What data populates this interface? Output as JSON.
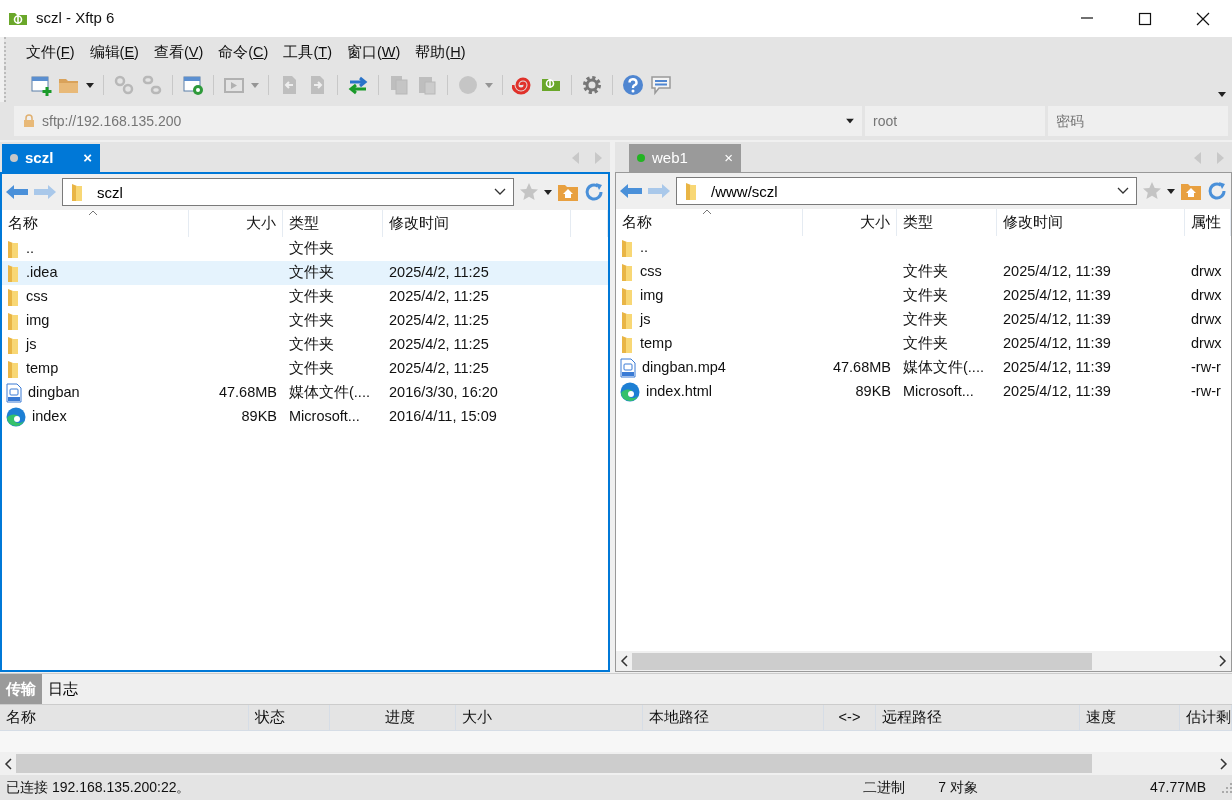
{
  "window": {
    "title": "sczl - Xftp 6"
  },
  "menu": [
    {
      "before": "文件(",
      "accel": "F",
      "after": ")"
    },
    {
      "before": "编辑(",
      "accel": "E",
      "after": ")"
    },
    {
      "before": "查看(",
      "accel": "V",
      "after": ")"
    },
    {
      "before": "命令(",
      "accel": "C",
      "after": ")"
    },
    {
      "before": "工具(",
      "accel": "T",
      "after": ")"
    },
    {
      "before": "窗口(",
      "accel": "W",
      "after": ")"
    },
    {
      "before": "帮助(",
      "accel": "H",
      "after": ")"
    }
  ],
  "toolbar": [
    {
      "kind": "new-session",
      "disabled": false,
      "menu": false,
      "separator_before": false
    },
    {
      "kind": "open",
      "disabled": false,
      "menu": true,
      "separator_before": false
    },
    {
      "kind": "link",
      "disabled": true,
      "menu": false,
      "separator_before": true
    },
    {
      "kind": "unlink",
      "disabled": true,
      "menu": false,
      "separator_before": false
    },
    {
      "kind": "properties",
      "disabled": false,
      "menu": false,
      "separator_before": true
    },
    {
      "kind": "play",
      "disabled": true,
      "menu": true,
      "separator_before": true
    },
    {
      "kind": "file-left",
      "disabled": true,
      "menu": false,
      "separator_before": true
    },
    {
      "kind": "file-right",
      "disabled": true,
      "menu": false,
      "separator_before": false
    },
    {
      "kind": "transfer",
      "disabled": false,
      "menu": false,
      "separator_before": true
    },
    {
      "kind": "copy",
      "disabled": true,
      "menu": false,
      "separator_before": true
    },
    {
      "kind": "paste",
      "disabled": true,
      "menu": false,
      "separator_before": false
    },
    {
      "kind": "circle",
      "disabled": true,
      "menu": true,
      "separator_before": true
    },
    {
      "kind": "swirl",
      "disabled": false,
      "menu": false,
      "separator_before": true
    },
    {
      "kind": "logo",
      "disabled": false,
      "menu": false,
      "separator_before": false
    },
    {
      "kind": "gear",
      "disabled": false,
      "menu": false,
      "separator_before": true
    },
    {
      "kind": "help",
      "disabled": false,
      "menu": false,
      "separator_before": true
    },
    {
      "kind": "chat",
      "disabled": false,
      "menu": false,
      "separator_before": false
    }
  ],
  "address_bar": {
    "url_placeholder": "sftp://192.168.135.200",
    "user_placeholder": "root",
    "password_placeholder": "密码"
  },
  "panes": [
    {
      "tab": {
        "label": "sczl",
        "selected": true,
        "color": "#c8c8c8",
        "close": "×"
      },
      "path": "sczl",
      "columns": [
        {
          "label": "名称",
          "sorted": true
        },
        {
          "label": "大小",
          "sorted": false
        },
        {
          "label": "类型",
          "sorted": false
        },
        {
          "label": "修改时间",
          "sorted": false
        }
      ],
      "rows": [
        {
          "kind": "folder",
          "selected": false,
          "cells": [
            "..",
            "",
            "文件夹",
            ""
          ]
        },
        {
          "kind": "folder",
          "selected": true,
          "cells": [
            ".idea",
            "",
            "文件夹",
            "2025/4/2, 11:25"
          ]
        },
        {
          "kind": "folder",
          "selected": false,
          "cells": [
            "css",
            "",
            "文件夹",
            "2025/4/2, 11:25"
          ]
        },
        {
          "kind": "folder",
          "selected": false,
          "cells": [
            "img",
            "",
            "文件夹",
            "2025/4/2, 11:25"
          ]
        },
        {
          "kind": "folder",
          "selected": false,
          "cells": [
            "js",
            "",
            "文件夹",
            "2025/4/2, 11:25"
          ]
        },
        {
          "kind": "folder",
          "selected": false,
          "cells": [
            "temp",
            "",
            "文件夹",
            "2025/4/2, 11:25"
          ]
        },
        {
          "kind": "video",
          "selected": false,
          "cells": [
            "dingban",
            "47.68MB",
            "媒体文件(....",
            "2016/3/30, 16:20"
          ]
        },
        {
          "kind": "browser",
          "selected": false,
          "cells": [
            "index",
            "89KB",
            "Microsoft...",
            "2016/4/11, 15:09"
          ]
        }
      ],
      "hscroll": false
    },
    {
      "tab": {
        "label": "web1",
        "selected": false,
        "color": "#22b422",
        "close": "×"
      },
      "path": "/www/sczl",
      "columns": [
        {
          "label": "名称",
          "sorted": true
        },
        {
          "label": "大小",
          "sorted": false
        },
        {
          "label": "类型",
          "sorted": false
        },
        {
          "label": "修改时间",
          "sorted": false
        },
        {
          "label": "属性",
          "sorted": false
        }
      ],
      "rows": [
        {
          "kind": "folder",
          "selected": false,
          "cells": [
            "..",
            "",
            "",
            "",
            ""
          ]
        },
        {
          "kind": "folder",
          "selected": false,
          "cells": [
            "css",
            "",
            "文件夹",
            "2025/4/12, 11:39",
            "drwx"
          ]
        },
        {
          "kind": "folder",
          "selected": false,
          "cells": [
            "img",
            "",
            "文件夹",
            "2025/4/12, 11:39",
            "drwx"
          ]
        },
        {
          "kind": "folder",
          "selected": false,
          "cells": [
            "js",
            "",
            "文件夹",
            "2025/4/12, 11:39",
            "drwx"
          ]
        },
        {
          "kind": "folder",
          "selected": false,
          "cells": [
            "temp",
            "",
            "文件夹",
            "2025/4/12, 11:39",
            "drwx"
          ]
        },
        {
          "kind": "video",
          "selected": false,
          "cells": [
            "dingban.mp4",
            "47.68MB",
            "媒体文件(....",
            "2025/4/12, 11:39",
            "-rw-r"
          ]
        },
        {
          "kind": "browser",
          "selected": false,
          "cells": [
            "index.html",
            "89KB",
            "Microsoft...",
            "2025/4/12, 11:39",
            "-rw-r"
          ]
        }
      ],
      "hscroll": true
    }
  ],
  "transfer": {
    "tabs": [
      {
        "label": "传输",
        "selected": true
      },
      {
        "label": "日志",
        "selected": false
      }
    ],
    "columns": [
      "名称",
      "状态",
      "进度",
      "大小",
      "本地路径",
      "<->",
      "远程路径",
      "速度",
      "估计剩"
    ]
  },
  "status_bar": {
    "message": "已连接 192.168.135.200:22。",
    "mode": "二进制",
    "objects": "7 对象",
    "total": "47.77MB"
  }
}
